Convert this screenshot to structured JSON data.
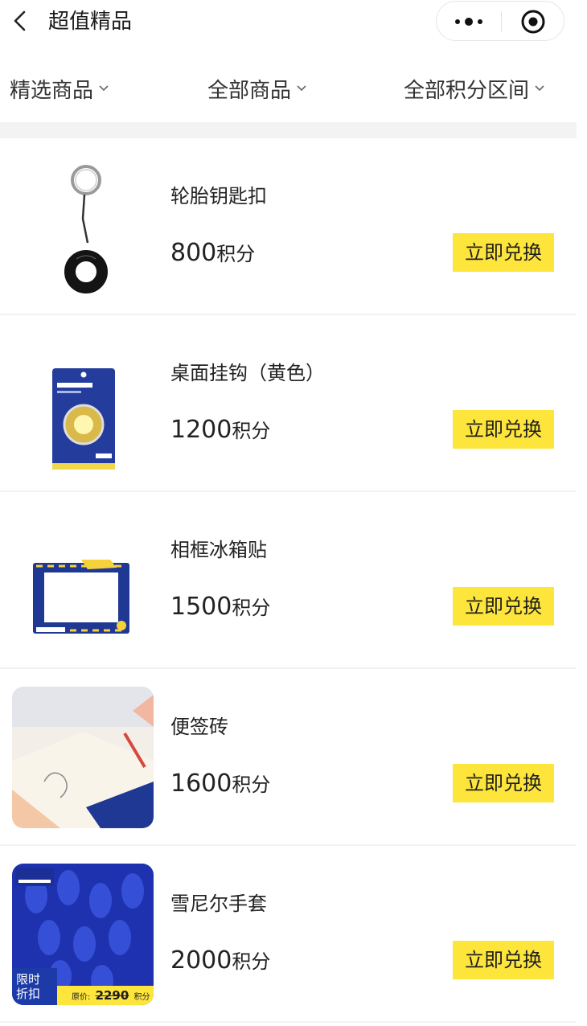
{
  "header": {
    "title": "超值精品",
    "back_icon": "chevron-left-icon",
    "more_icon": "more-dots-icon",
    "close_icon": "target-close-icon"
  },
  "filters": [
    {
      "label": "精选商品",
      "icon": "chevron-down-icon"
    },
    {
      "label": "全部商品",
      "icon": "chevron-down-icon"
    },
    {
      "label": "全部积分区间",
      "icon": "chevron-down-icon"
    }
  ],
  "products": [
    {
      "name": "轮胎钥匙扣",
      "points": "800",
      "unit": "积分",
      "button": "立即兑换"
    },
    {
      "name": "桌面挂钩（黄色）",
      "points": "1200",
      "unit": "积分",
      "button": "立即兑换"
    },
    {
      "name": "相框冰箱贴",
      "points": "1500",
      "unit": "积分",
      "button": "立即兑换"
    },
    {
      "name": "便签砖",
      "points": "1600",
      "unit": "积分",
      "button": "立即兑换"
    },
    {
      "name": "雪尼尔手套",
      "points": "2000",
      "unit": "积分",
      "button": "立即兑换",
      "image_badge": {
        "line1": "限时",
        "line2": "折扣",
        "orig_label": "原价:",
        "orig_price": "2290",
        "orig_unit": "积分"
      }
    }
  ],
  "colors": {
    "accent_yellow": "#fde53c",
    "brand_blue": "#1d3ba8",
    "divider": "#f3f3f3"
  }
}
